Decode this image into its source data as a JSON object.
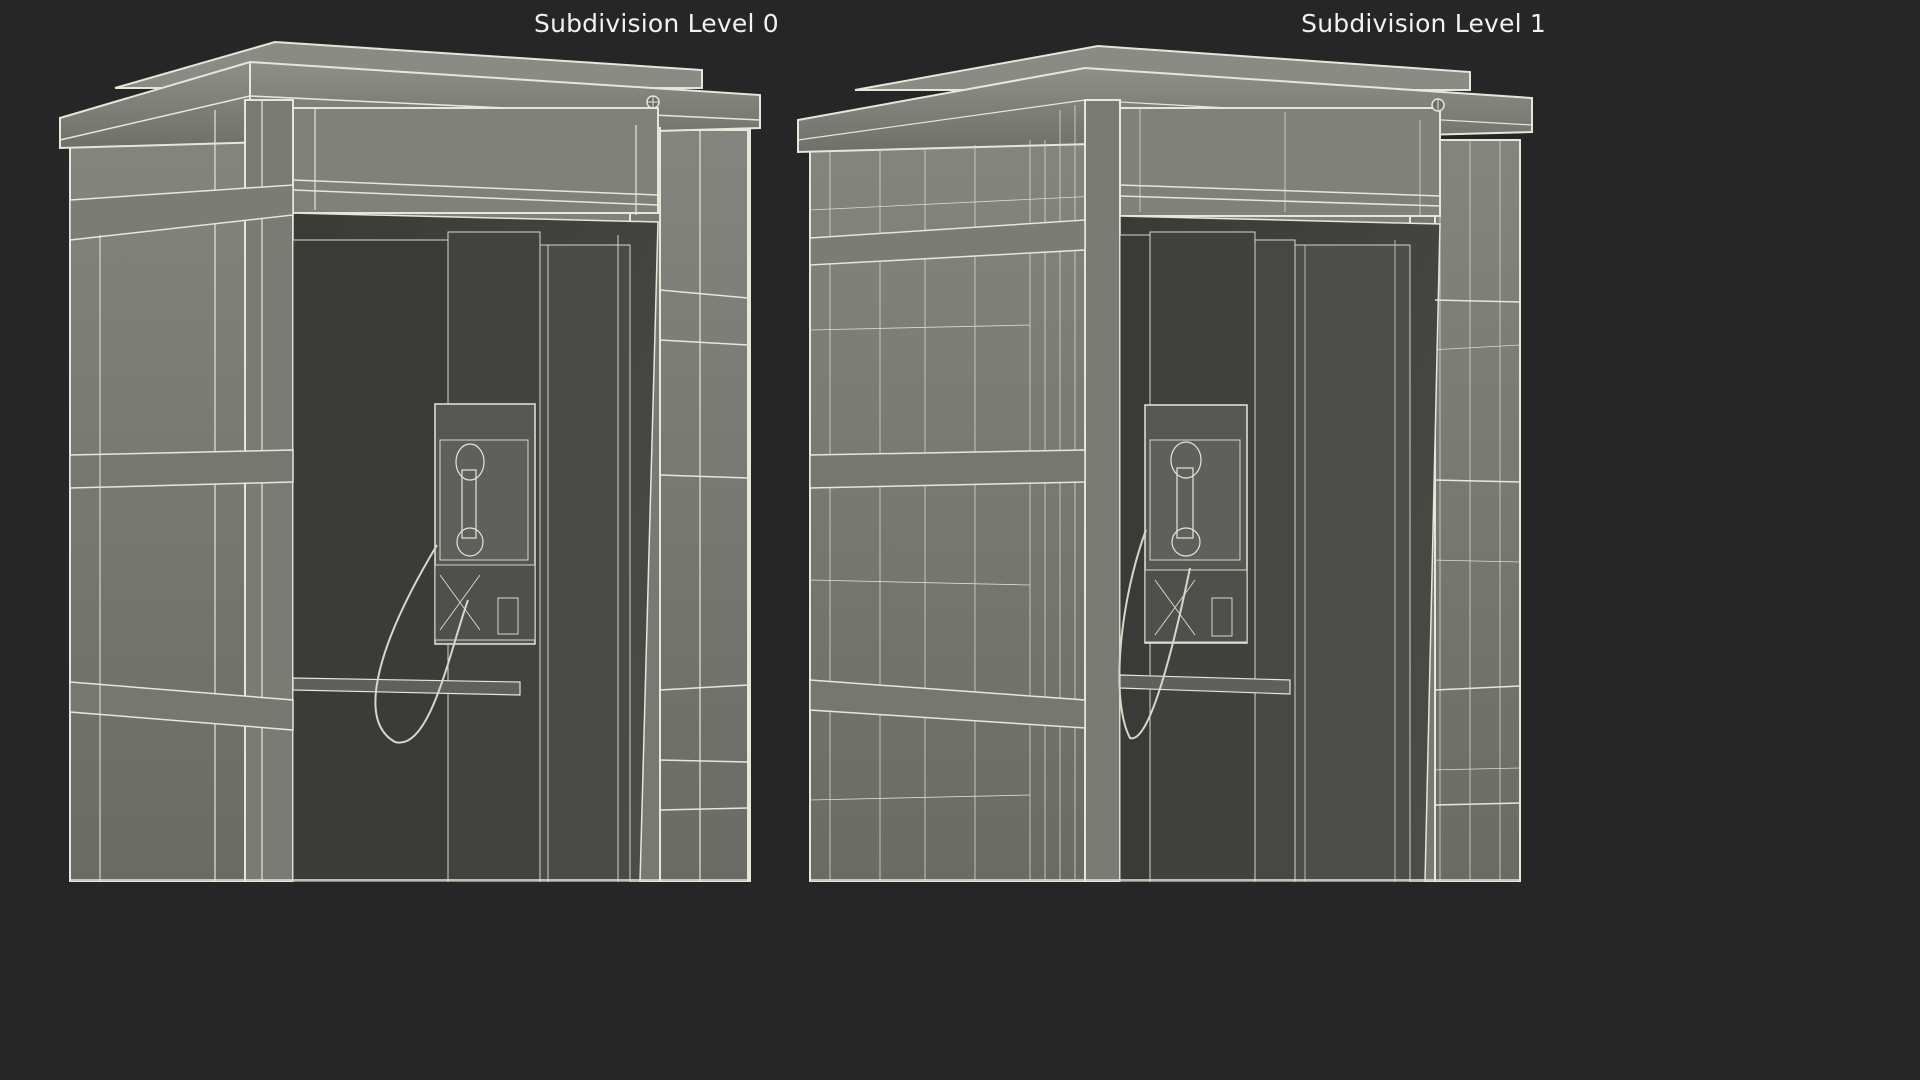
{
  "views": [
    {
      "label": "Subdivision Level 0"
    },
    {
      "label": "Subdivision Level 1"
    }
  ],
  "colors": {
    "background": "#262626",
    "panel": "#7c7d76",
    "panel_dark": "#5a5b55",
    "interior": "#3e3f3b",
    "wire": "#e8e6d8",
    "label": "#f2f2f2"
  },
  "icons": [
    "globe-logo-icon",
    "globe-logo-icon"
  ]
}
